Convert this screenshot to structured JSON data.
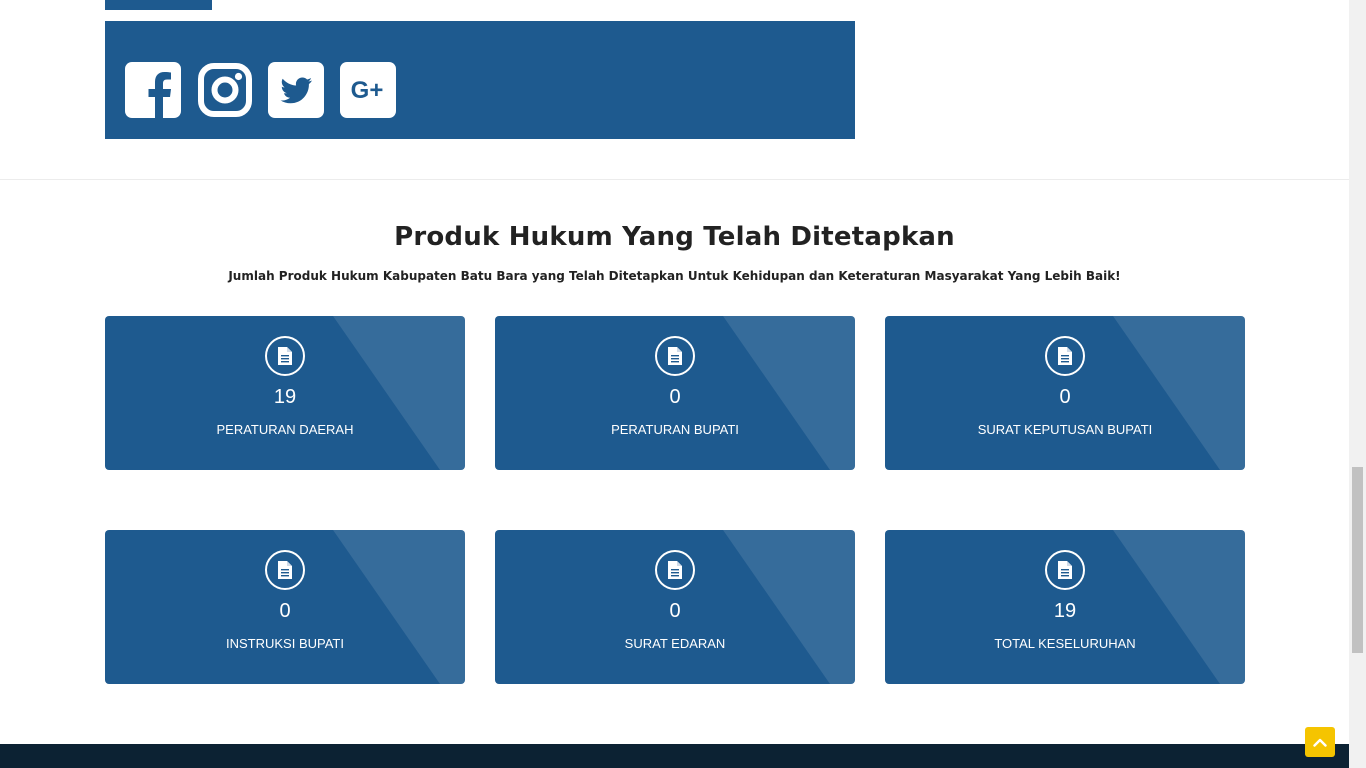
{
  "social": {
    "icons": [
      "facebook-icon",
      "instagram-icon",
      "twitter-icon",
      "google-plus-icon"
    ],
    "google_plus_text": "G+"
  },
  "section": {
    "title": "Produk Hukum Yang Telah Ditetapkan",
    "subtitle": "Jumlah Produk Hukum Kabupaten Batu Bara yang Telah Ditetapkan Untuk Kehidupan dan Keteraturan Masyarakat Yang Lebih Baik!"
  },
  "stats": [
    {
      "count": "19",
      "label": "PERATURAN DAERAH"
    },
    {
      "count": "0",
      "label": "PERATURAN BUPATI"
    },
    {
      "count": "0",
      "label": "SURAT KEPUTUSAN BUPATI"
    },
    {
      "count": "0",
      "label": "INSTRUKSI BUPATI"
    },
    {
      "count": "0",
      "label": "SURAT EDARAN"
    },
    {
      "count": "19",
      "label": "TOTAL KESELURUHAN"
    }
  ],
  "colors": {
    "primary": "#1e5a8f",
    "footer": "#0c2233",
    "back_to_top": "#f5c400"
  },
  "back_to_top": {
    "icon": "chevron-up-icon"
  }
}
